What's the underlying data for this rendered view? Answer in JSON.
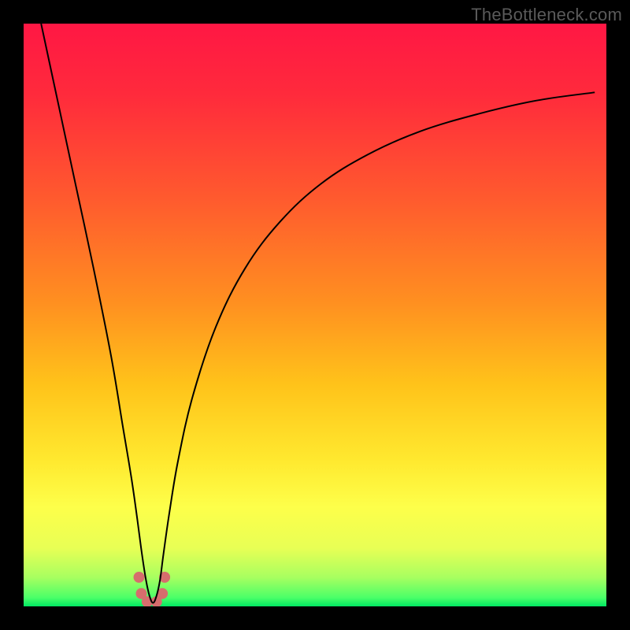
{
  "watermark": "TheBottleneck.com",
  "chart_data": {
    "type": "line",
    "title": "",
    "xlabel": "",
    "ylabel": "",
    "xlim": [
      0,
      100
    ],
    "ylim": [
      0,
      100
    ],
    "grid": false,
    "legend": null,
    "notes": "No axes, ticks, or numeric labels are shown. Background is a vertical red→yellow→green gradient. A black V-shaped curve dips to ~0 near x≈22; a salmon U-shaped marker cluster sits at the valley bottom. Values are estimated from pixel positions on a 0–100 normalized scale.",
    "gradient_stops": [
      {
        "offset": 0.0,
        "color": "#ff1744"
      },
      {
        "offset": 0.12,
        "color": "#ff2a3c"
      },
      {
        "offset": 0.3,
        "color": "#ff5a2e"
      },
      {
        "offset": 0.48,
        "color": "#ff9020"
      },
      {
        "offset": 0.62,
        "color": "#ffc31a"
      },
      {
        "offset": 0.75,
        "color": "#ffe92f"
      },
      {
        "offset": 0.83,
        "color": "#fdff4a"
      },
      {
        "offset": 0.9,
        "color": "#e8ff55"
      },
      {
        "offset": 0.95,
        "color": "#a8ff60"
      },
      {
        "offset": 0.985,
        "color": "#4bff68"
      },
      {
        "offset": 1.0,
        "color": "#00e963"
      }
    ],
    "series": [
      {
        "name": "bottleneck-curve",
        "color": "#000000",
        "stroke_width": 2,
        "x": [
          3.0,
          6.0,
          9.0,
          12.0,
          15.0,
          17.0,
          18.5,
          19.5,
          20.3,
          21.0,
          21.6,
          22.2,
          22.8,
          23.4,
          24.0,
          25.0,
          26.5,
          29.0,
          33.0,
          38.0,
          44.0,
          51.0,
          59.0,
          68.0,
          78.0,
          88.0,
          98.0
        ],
        "y": [
          100.0,
          86.0,
          72.0,
          58.0,
          43.0,
          31.0,
          22.0,
          15.0,
          9.0,
          4.5,
          1.8,
          0.6,
          1.8,
          4.5,
          9.0,
          16.0,
          25.0,
          36.0,
          48.0,
          58.0,
          66.0,
          72.5,
          77.5,
          81.5,
          84.5,
          86.8,
          88.2
        ]
      }
    ],
    "marker_cluster": {
      "name": "valley-markers",
      "color": "#d66d6d",
      "radius": 7,
      "points": [
        {
          "x": 19.8,
          "y": 5.0
        },
        {
          "x": 20.2,
          "y": 2.2
        },
        {
          "x": 21.2,
          "y": 0.8
        },
        {
          "x": 22.8,
          "y": 0.8
        },
        {
          "x": 23.8,
          "y": 2.2
        },
        {
          "x": 24.2,
          "y": 5.0
        }
      ]
    }
  }
}
